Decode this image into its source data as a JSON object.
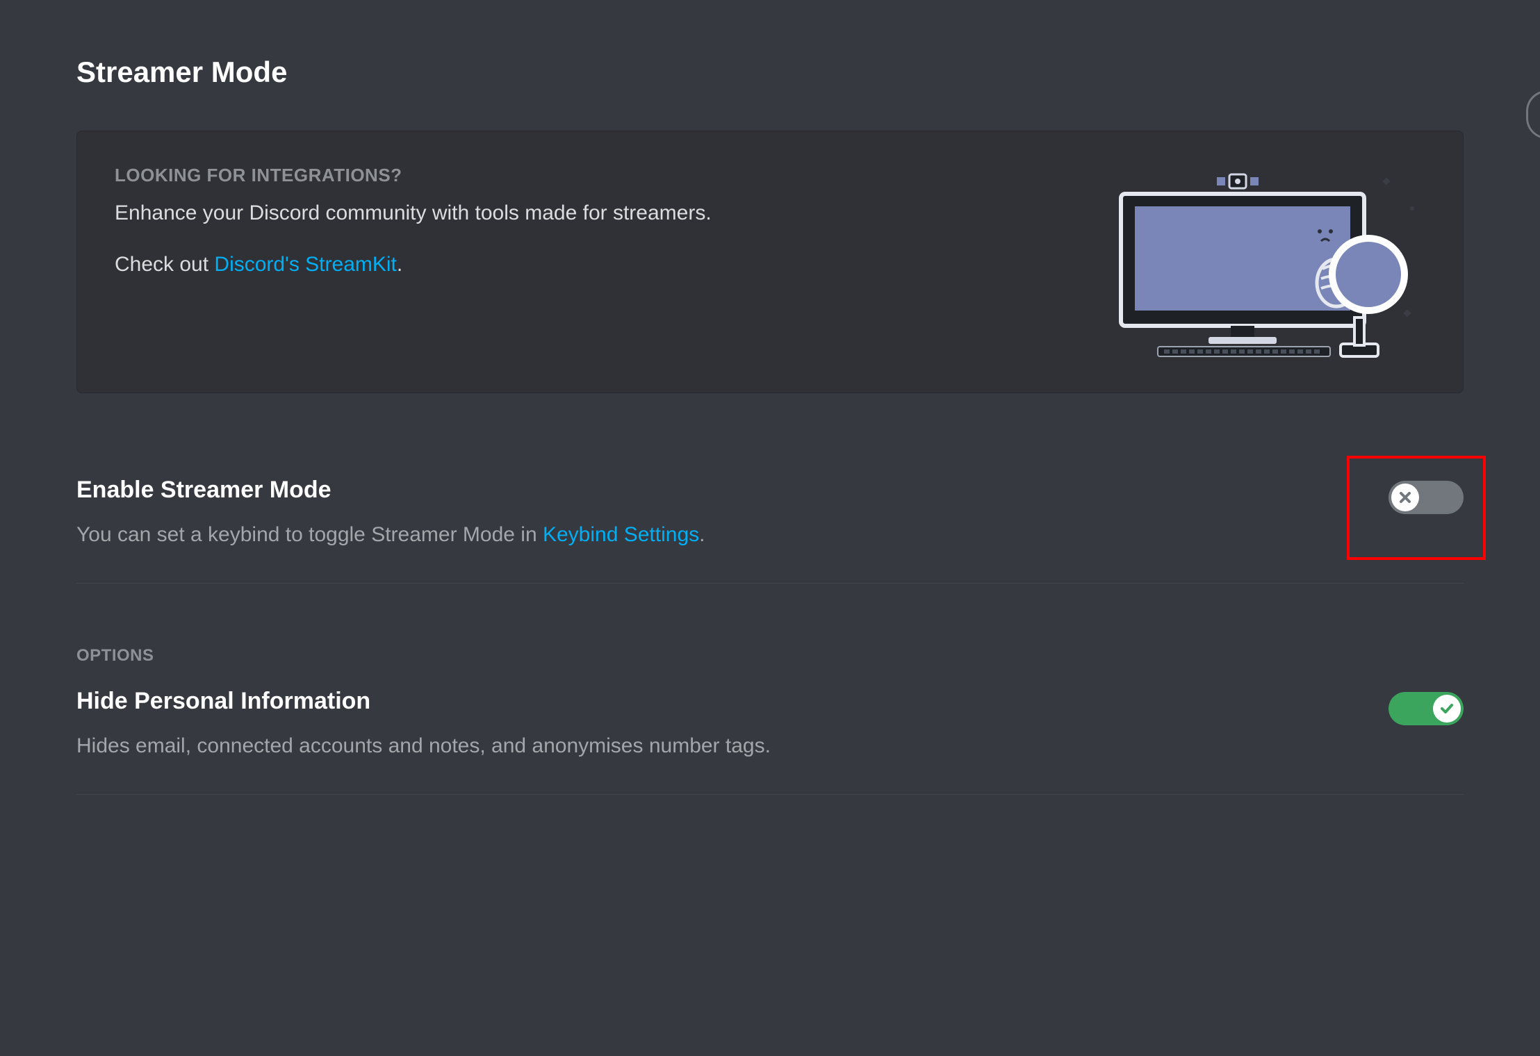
{
  "page": {
    "title": "Streamer Mode"
  },
  "promo": {
    "eyebrow": "LOOKING FOR INTEGRATIONS?",
    "line1": "Enhance your Discord community with tools made for streamers.",
    "checkout_prefix": "Check out ",
    "link_text": "Discord's StreamKit",
    "checkout_suffix": "."
  },
  "settings": {
    "enable": {
      "title": "Enable Streamer Mode",
      "desc_prefix": "You can set a keybind to toggle Streamer Mode in ",
      "desc_link": "Keybind Settings",
      "desc_suffix": ".",
      "value": false
    }
  },
  "options": {
    "header": "OPTIONS",
    "hide_personal": {
      "title": "Hide Personal Information",
      "desc": "Hides email, connected accounts and notes, and anonymises number tags.",
      "value": true
    }
  },
  "colors": {
    "link": "#00aff4",
    "toggle_on": "#3ba55d",
    "toggle_off": "#72767d",
    "highlight": "#ff0000"
  }
}
